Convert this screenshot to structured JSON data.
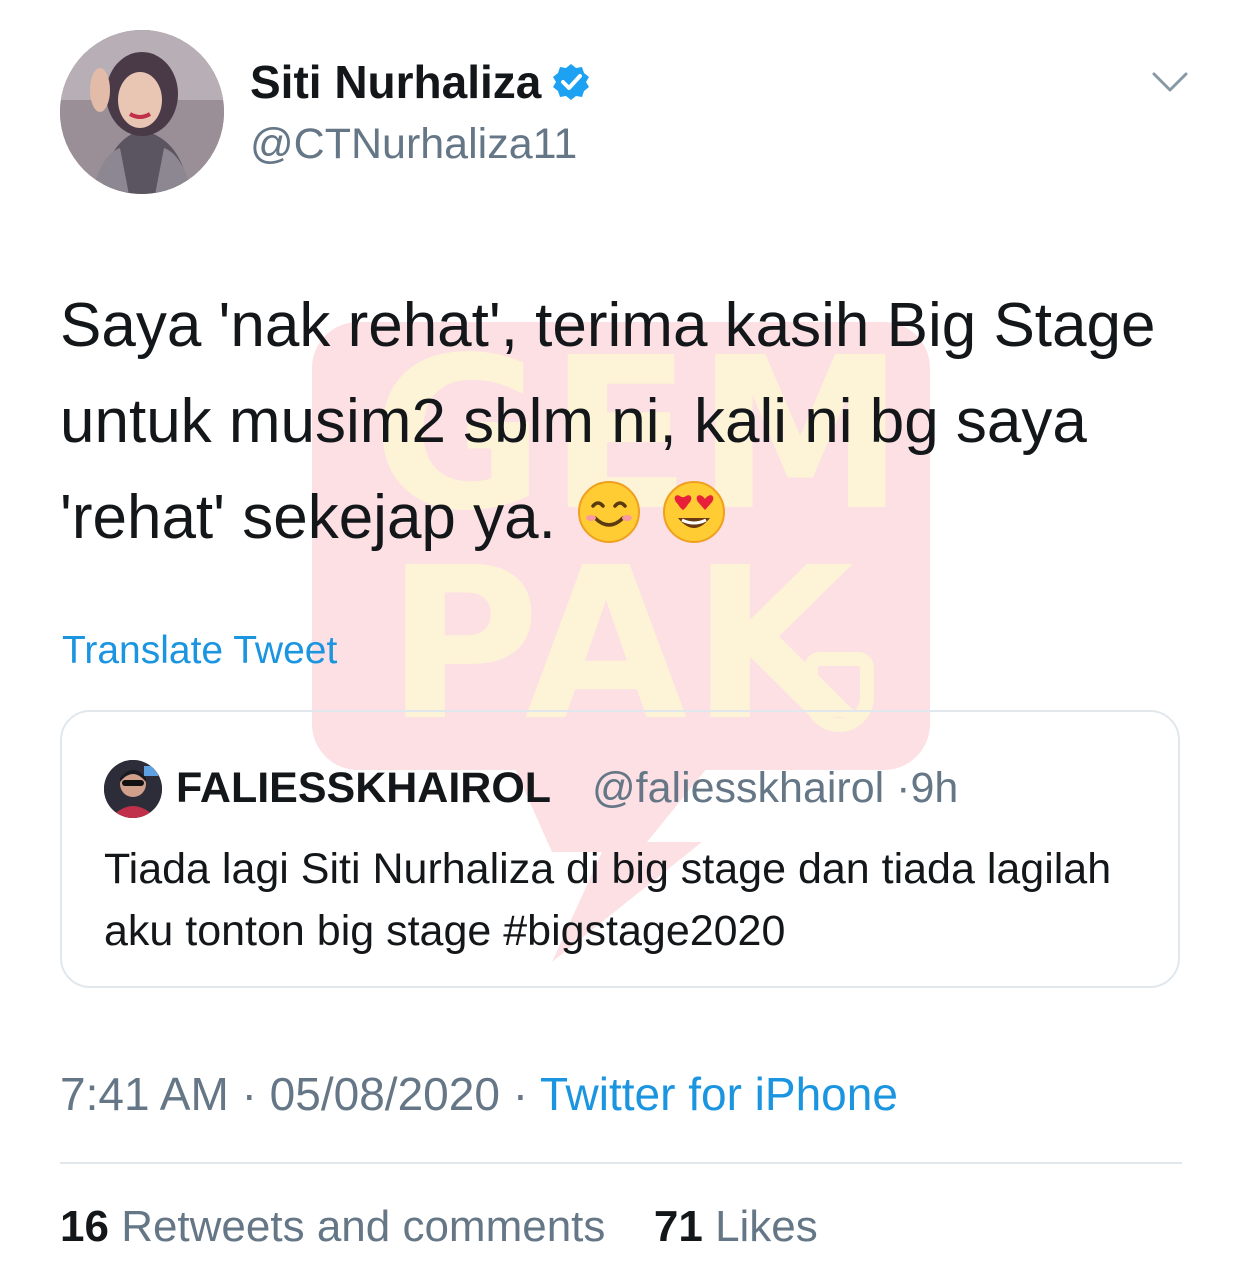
{
  "author": {
    "display_name": "Siti Nurhaliza",
    "handle": "@CTNurhaliza11",
    "verified": true
  },
  "tweet": {
    "text": "Saya 'nak rehat', terima kasih Big Stage untuk musim2 sblm ni, kali ni bg saya 'rehat' sekejap ya.",
    "emojis": [
      "smiling-face-emoji",
      "heart-eyes-emoji"
    ],
    "translate_label": "Translate Tweet"
  },
  "quoted_tweet": {
    "display_name": "FALIESSKHAIROL",
    "handle": "@faliesskhairol",
    "time": "9h",
    "separator": "·",
    "text": "Tiada lagi Siti Nurhaliza di big stage dan tiada lagilah aku tonton big stage #bigstage2020"
  },
  "meta": {
    "time": "7:41 AM",
    "date": "05/08/2020",
    "separator": "·",
    "source": "Twitter for iPhone"
  },
  "stats": {
    "retweets_count": "16",
    "retweets_label": "Retweets and comments",
    "likes_count": "71",
    "likes_label": "Likes"
  },
  "watermark": {
    "line1": "GEM",
    "line2": "PAK"
  },
  "colors": {
    "link": "#1b95e0",
    "secondary_text": "#657786",
    "primary_text": "#14171a",
    "border": "#e1e8ed",
    "watermark_bg": "#fde0e4",
    "watermark_fg": "#fdf3d6"
  }
}
